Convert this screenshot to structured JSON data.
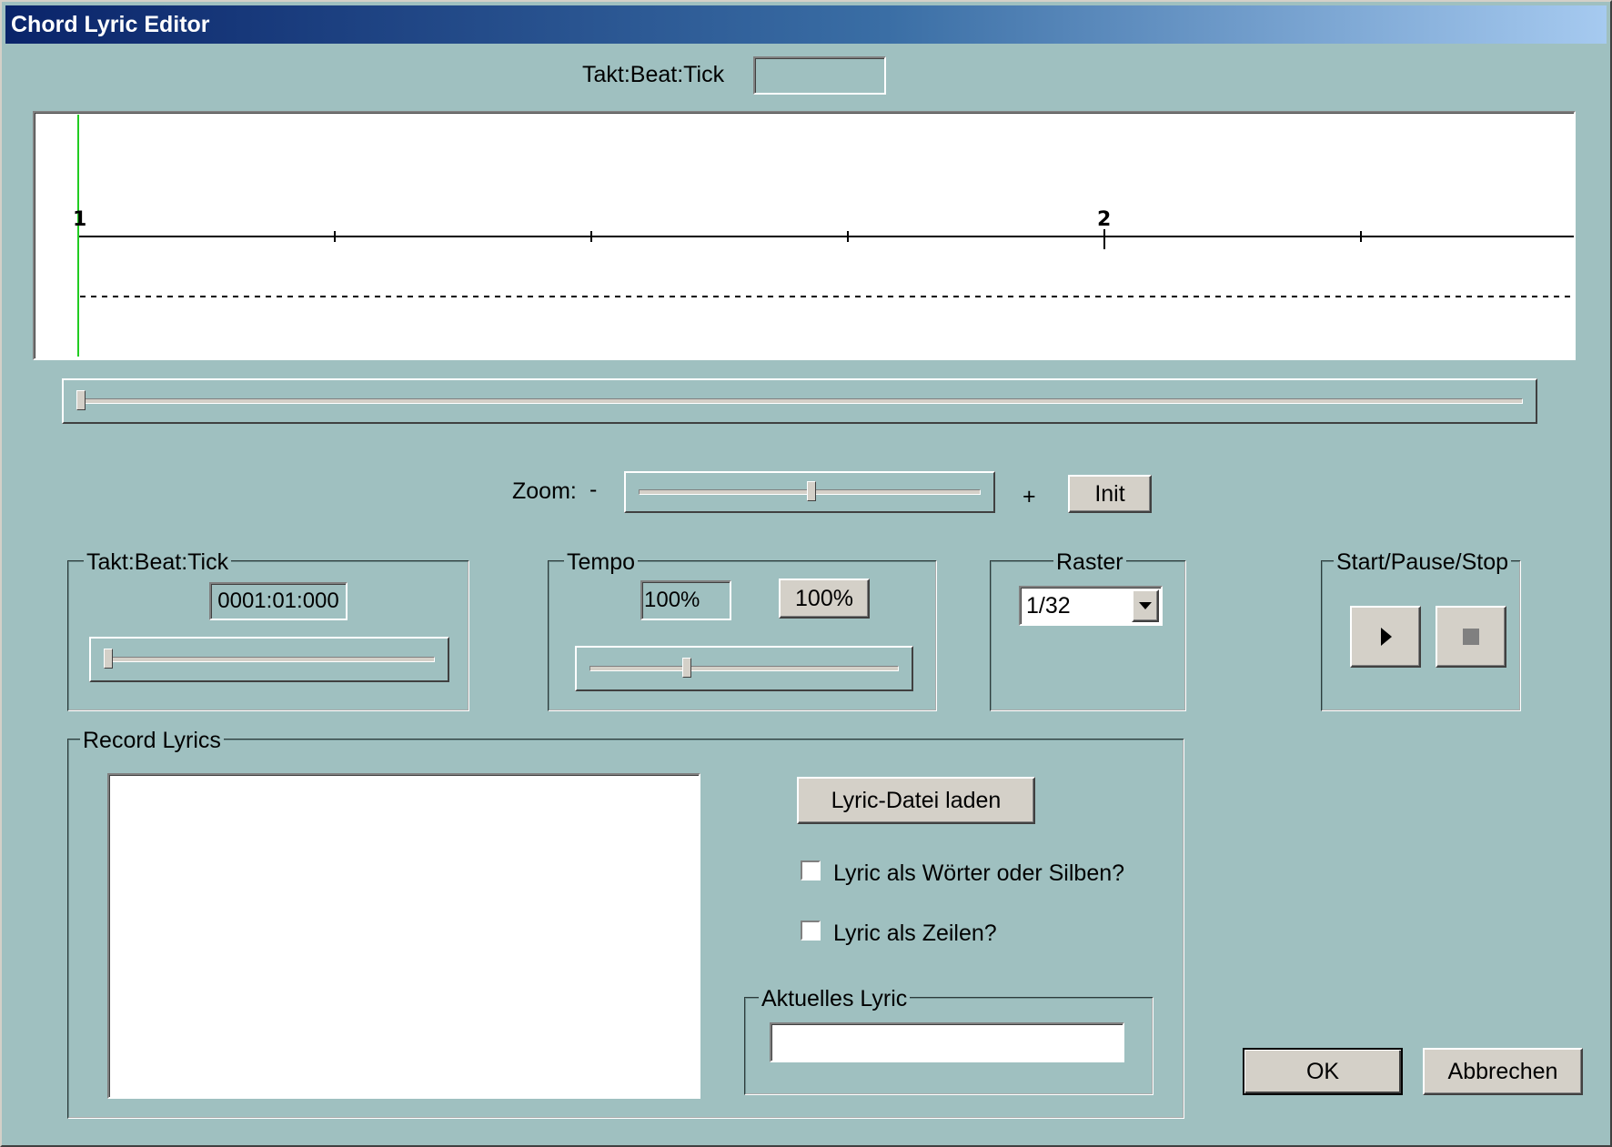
{
  "window": {
    "title": "Chord Lyric Editor"
  },
  "top_position": {
    "label": "Takt:Beat:Tick",
    "value": ""
  },
  "timeline": {
    "bar_labels": [
      "1",
      "2"
    ]
  },
  "scroll_slider": {
    "position": 0
  },
  "zoom": {
    "label": "Zoom:",
    "minus": "-",
    "plus": "+",
    "level": 0.5,
    "init_button": "Init"
  },
  "position_group": {
    "label": "Takt:Beat:Tick",
    "value": "0001:01:000",
    "slider_position": 0
  },
  "tempo_group": {
    "label": "Tempo",
    "value": "100%",
    "reset_button": "100%",
    "slider_level": 0.35
  },
  "raster_group": {
    "label": "Raster",
    "selected": "1/32"
  },
  "transport_group": {
    "label": "Start/Pause/Stop",
    "play_icon": "play-icon",
    "stop_icon": "stop-icon"
  },
  "record_lyrics": {
    "label": "Record Lyrics",
    "text": "",
    "load_button": "Lyric-Datei laden",
    "words_checkbox": {
      "label": "Lyric als Wörter oder Silben?",
      "checked": false
    },
    "lines_checkbox": {
      "label": "Lyric als Zeilen?",
      "checked": false
    },
    "current_group": {
      "label": "Aktuelles Lyric",
      "value": ""
    }
  },
  "dialog_buttons": {
    "ok": "OK",
    "cancel": "Abbrechen"
  },
  "colors": {
    "background": "#9fc0c0",
    "playhead": "#22cc22"
  }
}
